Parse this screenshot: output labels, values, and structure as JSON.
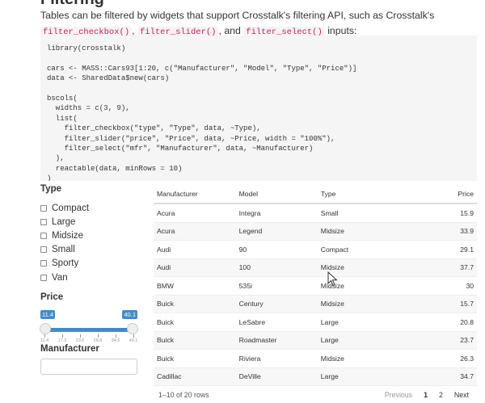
{
  "heading": "Filtering",
  "intro": {
    "text1": "Tables can be filtered by widgets that support Crosstalk's filtering API, such as Crosstalk's ",
    "code1": "filter_checkbox()",
    "sep1": ",",
    "code2": "filter_slider()",
    "sep2": ", and ",
    "code3": "filter_select()",
    "text2": " inputs:"
  },
  "code_block": "library(crosstalk)\n\ncars <- MASS::Cars93[1:20, c(\"Manufacturer\", \"Model\", \"Type\", \"Price\")]\ndata <- SharedData$new(cars)\n\nbscols(\n  widths = c(3, 9),\n  list(\n    filter_checkbox(\"type\", \"Type\", data, ~Type),\n    filter_slider(\"price\", \"Price\", data, ~Price, width = \"100%\"),\n    filter_select(\"mfr\", \"Manufacturer\", data, ~Manufacturer)\n  ),\n  reactable(data, minRows = 10)\n)",
  "filters": {
    "type_title": "Type",
    "types": [
      "Compact",
      "Large",
      "Midsize",
      "Small",
      "Sporty",
      "Van"
    ],
    "price_title": "Price",
    "price_min": "11.4",
    "price_max": "40.1",
    "price_ticks": [
      "11.4",
      "17.2",
      "23.0",
      "28.8",
      "34.6",
      "40.1"
    ],
    "manufacturer_title": "Manufacturer"
  },
  "table": {
    "headers": [
      "Manufacturer",
      "Model",
      "Type",
      "Price"
    ],
    "rows": [
      [
        "Acura",
        "Integra",
        "Small",
        "15.9"
      ],
      [
        "Acura",
        "Legend",
        "Midsize",
        "33.9"
      ],
      [
        "Audi",
        "90",
        "Compact",
        "29.1"
      ],
      [
        "Audi",
        "100",
        "Midsize",
        "37.7"
      ],
      [
        "BMW",
        "535i",
        "Midsize",
        "30"
      ],
      [
        "Buick",
        "Century",
        "Midsize",
        "15.7"
      ],
      [
        "Buick",
        "LeSabre",
        "Large",
        "20.8"
      ],
      [
        "Buick",
        "Roadmaster",
        "Large",
        "23.7"
      ],
      [
        "Buick",
        "Riviera",
        "Midsize",
        "26.3"
      ],
      [
        "Cadillac",
        "DeVille",
        "Large",
        "34.7"
      ]
    ]
  },
  "pagination": {
    "row_info": "1–10 of 20 rows",
    "previous": "Previous",
    "page1": "1",
    "page2": "2",
    "next": "Next"
  },
  "colors": {
    "accent": "#428bca",
    "code_text": "#c7254e"
  }
}
